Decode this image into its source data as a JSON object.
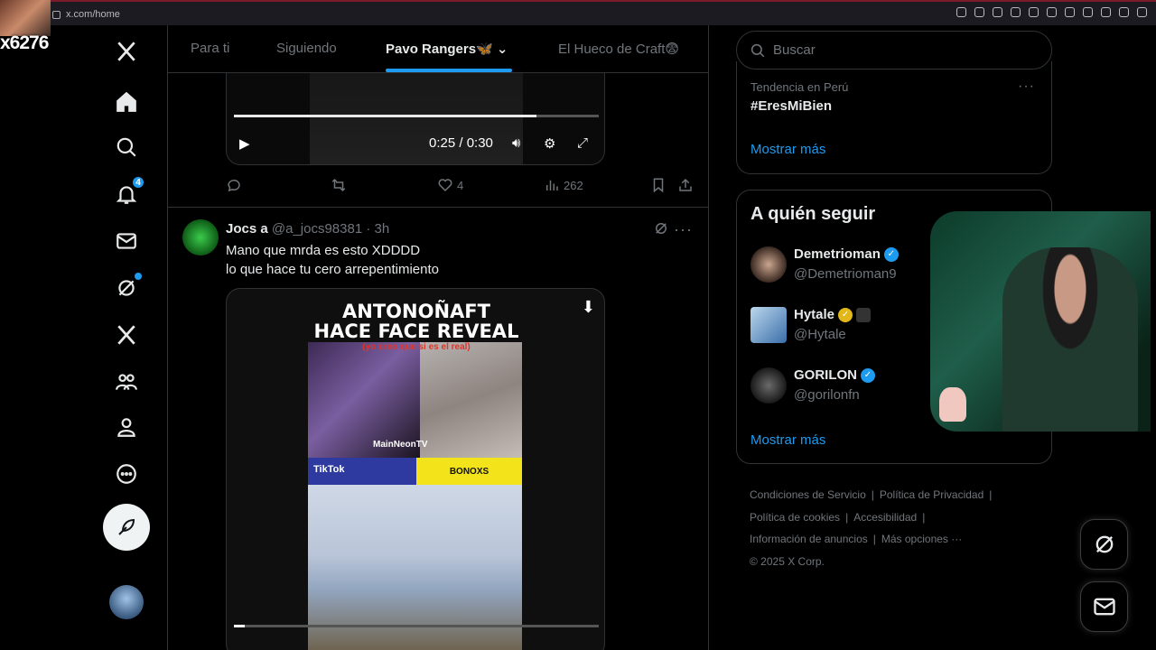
{
  "browser": {
    "url": "x.com/home"
  },
  "overlay": {
    "streamer_id": "x6276"
  },
  "nav": {
    "notifications_badge": "4"
  },
  "tabs": [
    {
      "label": "Para ti"
    },
    {
      "label": "Siguiendo"
    },
    {
      "label": "Pavo Rangers🦋"
    },
    {
      "label": "El Hueco de Craft😨"
    }
  ],
  "active_tab": "Pavo Rangers🦋",
  "tweet1": {
    "video_time": "0:25 / 0:30",
    "video_progress": 0.83,
    "likes": "4",
    "views": "262"
  },
  "tweet2": {
    "name": "Jocs a",
    "handle": "@a_jocs98381 · 3h",
    "text_line1": "Mano que mrda es esto XDDDD",
    "text_line2": "lo que hace tu cero arrepentimiento",
    "video": {
      "title_line1": "ANTONOÑAFT",
      "title_line2": "HACE FACE REVEAL",
      "subtitle": "(yo creo que si es el real)",
      "channel_tag": "MainNeonTV",
      "tiktok_tag": "TikTok",
      "band_text": "BONOXS",
      "progress": 0.03
    }
  },
  "search": {
    "placeholder": "Buscar"
  },
  "trend": {
    "category": "Tendencia en Perú",
    "name": "#EresMiBien",
    "show_more": "Mostrar más"
  },
  "who_to_follow": {
    "title": "A quién seguir",
    "accounts": [
      {
        "name": "Demetrioman",
        "handle": "@Demetrioman9",
        "badge_color": "#1d9bf0"
      },
      {
        "name": "Hytale",
        "handle": "@Hytale",
        "badge_color": "#e2b719"
      },
      {
        "name": "GORILON",
        "handle": "@gorilonfn",
        "badge_color": "#1d9bf0"
      }
    ],
    "show_more": "Mostrar más"
  },
  "footer": {
    "terms": "Condiciones de Servicio",
    "privacy": "Política de Privacidad",
    "cookies": "Política de cookies",
    "accessibility": "Accesibilidad",
    "ads": "Información de anuncios",
    "more": "Más opciones ···",
    "copyright": "© 2025 X Corp."
  },
  "colors": {
    "accent": "#1d9bf0",
    "background": "#000000",
    "border": "#2f3336"
  }
}
